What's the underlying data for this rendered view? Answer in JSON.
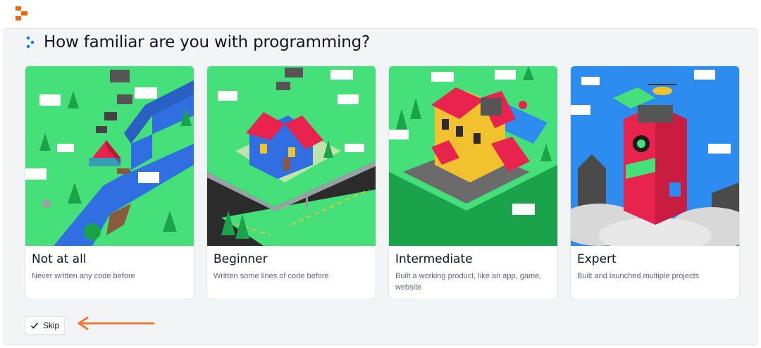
{
  "app": {
    "logo_icon": "replit-logo-icon",
    "brand_color": "#F26207"
  },
  "question": {
    "text": "How familiar are you with programming?",
    "icon": "dots-icon",
    "icon_color": "#0079F2"
  },
  "options": [
    {
      "title": "Not at all",
      "description": "Never written any code before",
      "illustration": "campsite-illustration"
    },
    {
      "title": "Beginner",
      "description": "Written some lines of code before",
      "illustration": "house-illustration"
    },
    {
      "title": "Intermediate",
      "description": "Built a working product, like an app, game, website",
      "illustration": "mansion-illustration"
    },
    {
      "title": "Expert",
      "description": "Built and launched multiple projects",
      "illustration": "replit-tower-illustration"
    }
  ],
  "skip": {
    "label": "Skip",
    "icon": "check-icon"
  },
  "annotation": {
    "arrow_color": "#F07A3A"
  },
  "colors": {
    "grass": "#45E07A",
    "water": "#2F6FE0",
    "sky": "#2D8CF0",
    "roof": "#E8244E",
    "wall_yellow": "#F2C12E"
  }
}
